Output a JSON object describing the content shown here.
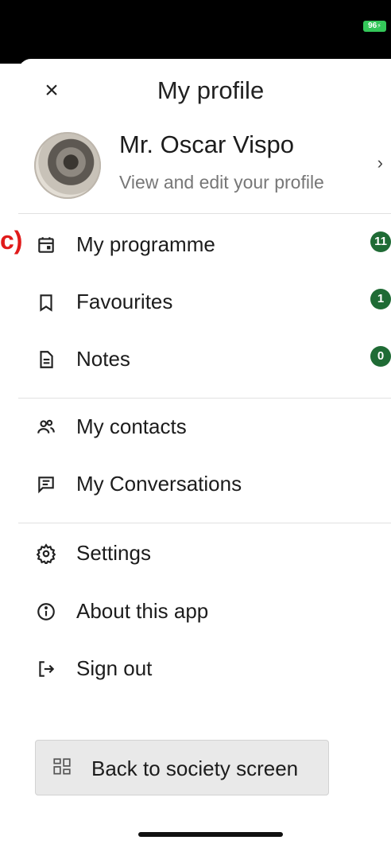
{
  "status_bar": {
    "battery": "96"
  },
  "header": {
    "close_label": "×",
    "title": "My profile"
  },
  "profile": {
    "name": "Mr. Oscar Vispo",
    "subtitle": "View and edit your profile",
    "chevron": "›"
  },
  "annotation": "c)",
  "menu_group1": [
    {
      "label": "My programme",
      "icon": "calendar-icon",
      "badge": "11"
    },
    {
      "label": "Favourites",
      "icon": "bookmark-icon",
      "badge": "1"
    },
    {
      "label": "Notes",
      "icon": "document-icon",
      "badge": "0"
    }
  ],
  "menu_group2": [
    {
      "label": "My contacts",
      "icon": "contacts-icon"
    },
    {
      "label": "My Conversations",
      "icon": "chat-icon"
    }
  ],
  "menu_group3": [
    {
      "label": "Settings",
      "icon": "gear-icon"
    },
    {
      "label": "About this app",
      "icon": "info-icon"
    },
    {
      "label": "Sign out",
      "icon": "sign-out-icon"
    }
  ],
  "back_button": {
    "label": "Back to society screen",
    "icon": "grid-icon"
  },
  "colors": {
    "badge": "#1f6b35",
    "annotation": "#e01b1b",
    "battery": "#34c759"
  }
}
